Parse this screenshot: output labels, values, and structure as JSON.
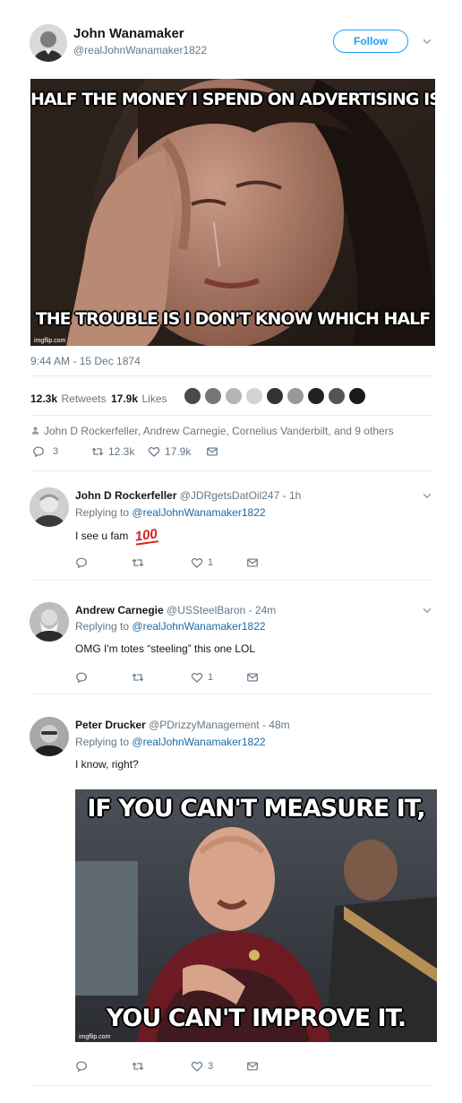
{
  "tweet": {
    "author_name": "John Wanamaker",
    "author_handle": "@realJohnWanamaker1822",
    "follow_label": "Follow",
    "meme_top": "HALF THE MONEY I SPEND ON ADVERTISING IS WASTED;",
    "meme_bottom": "THE TROUBLE IS I DON'T KNOW WHICH HALF",
    "watermark": "imgflip.com",
    "timestamp": "9:44 AM - 15 Dec 1874",
    "retweets_count": "12.3k",
    "retweets_label": "Retweets",
    "likes_count": "17.9k",
    "likes_label": "Likes",
    "liked_by": "John D Rockerfeller, Andrew Carnegie, Cornelius Vanderbilt, and 9 others",
    "reply_count": "3",
    "retweet_action_count": "12.3k",
    "like_action_count": "17.9k"
  },
  "replies": [
    {
      "name": "John D Rockerfeller",
      "handle": "@JDRgetsDatOil247 - 1h",
      "replying_prefix": "Replying to",
      "replying_to": "@realJohnWanamaker1822",
      "text": "I see u fam",
      "emoji": "100",
      "like_count": "1"
    },
    {
      "name": "Andrew Carnegie",
      "handle": "@USSteelBaron - 24m",
      "replying_prefix": "Replying to",
      "replying_to": "@realJohnWanamaker1822",
      "text": "OMG I'm totes “steeling” this one LOL",
      "like_count": "1"
    },
    {
      "name": "Peter Drucker",
      "handle": "@PDrizzyManagement - 48m",
      "replying_prefix": "Replying to",
      "replying_to": "@realJohnWanamaker1822",
      "text": "I know, right?",
      "meme_top": "IF YOU CAN'T MEASURE IT,",
      "meme_bottom": "YOU CAN'T IMPROVE IT.",
      "watermark": "imgflip.com",
      "like_count": "3"
    }
  ],
  "colors": {
    "accent": "#1da1f2",
    "link": "#1b6aa5",
    "muted": "#657786",
    "divider": "#e6ecf0",
    "emoji_red": "#d6201f"
  }
}
